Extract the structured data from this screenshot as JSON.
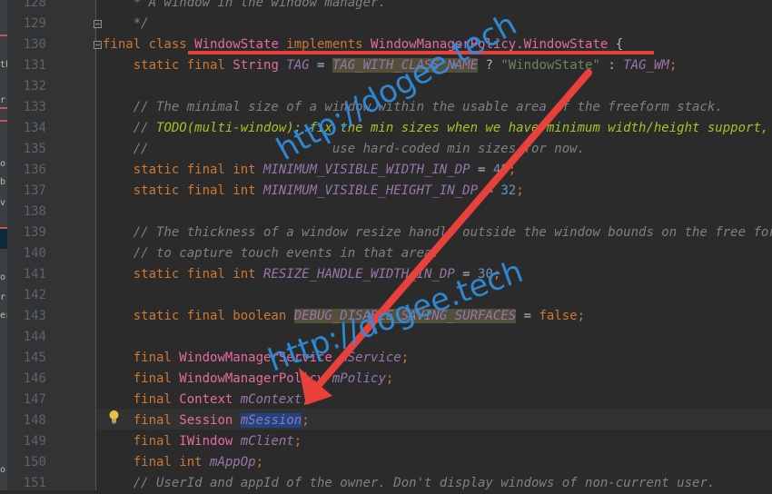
{
  "left_strip": {
    "glyphs": [
      "th",
      "r",
      "o",
      "b",
      "v",
      "o",
      "r",
      "er",
      "o"
    ]
  },
  "lines": [
    {
      "n": "128",
      "tokens": [
        {
          "t": "    * A window in the window manager.",
          "c": "cmt"
        }
      ]
    },
    {
      "n": "129",
      "tokens": [
        {
          "t": "    */",
          "c": "cmt"
        }
      ]
    },
    {
      "n": "130",
      "tokens": [
        {
          "t": "final class ",
          "c": "kw"
        },
        {
          "t": "WindowState",
          "c": "cls"
        },
        {
          "t": " implements ",
          "c": "kw"
        },
        {
          "t": "WindowManagerPolicy.WindowState",
          "c": "cls"
        },
        {
          "t": " {",
          "c": "plain"
        }
      ]
    },
    {
      "n": "131",
      "tokens": [
        {
          "t": "    static final ",
          "c": "kw"
        },
        {
          "t": "String ",
          "c": "cls"
        },
        {
          "t": "TAG",
          "c": "fld"
        },
        {
          "t": " = ",
          "c": "plain"
        },
        {
          "t": "TAG_WITH_CLASS_NAME",
          "c": "fld hl-gray"
        },
        {
          "t": " ? ",
          "c": "plain"
        },
        {
          "t": "\"WindowState\"",
          "c": "str"
        },
        {
          "t": " : ",
          "c": "plain"
        },
        {
          "t": "TAG_WM",
          "c": "fld"
        },
        {
          "t": ";",
          "c": "kw"
        }
      ]
    },
    {
      "n": "132",
      "tokens": []
    },
    {
      "n": "133",
      "tokens": [
        {
          "t": "    // The minimal size of a window within the usable area of the freeform stack.",
          "c": "cmt"
        }
      ]
    },
    {
      "n": "134",
      "tokens": [
        {
          "t": "    // ",
          "c": "cmt"
        },
        {
          "t": "TODO(multi-window): fix the min sizes when we have minimum width/height support,",
          "c": "todo"
        }
      ]
    },
    {
      "n": "135",
      "tokens": [
        {
          "t": "    //                        use hard-coded min sizes for now.",
          "c": "cmt"
        }
      ]
    },
    {
      "n": "136",
      "tokens": [
        {
          "t": "    static final int ",
          "c": "kw"
        },
        {
          "t": "MINIMUM_VISIBLE_WIDTH_IN_DP",
          "c": "fld"
        },
        {
          "t": " = ",
          "c": "plain"
        },
        {
          "t": "48",
          "c": "num"
        },
        {
          "t": ";",
          "c": "kw"
        }
      ]
    },
    {
      "n": "137",
      "tokens": [
        {
          "t": "    static final int ",
          "c": "kw"
        },
        {
          "t": "MINIMUM_VISIBLE_HEIGHT_IN_DP",
          "c": "fld"
        },
        {
          "t": " = ",
          "c": "plain"
        },
        {
          "t": "32",
          "c": "num"
        },
        {
          "t": ";",
          "c": "kw"
        }
      ]
    },
    {
      "n": "138",
      "tokens": []
    },
    {
      "n": "139",
      "tokens": [
        {
          "t": "    // The thickness of a window resize handle outside the window bounds on the free form wo",
          "c": "cmt"
        }
      ]
    },
    {
      "n": "140",
      "tokens": [
        {
          "t": "    // to capture touch events in that area.",
          "c": "cmt"
        }
      ]
    },
    {
      "n": "141",
      "tokens": [
        {
          "t": "    static final int ",
          "c": "kw"
        },
        {
          "t": "RESIZE_HANDLE_WIDTH_IN_DP",
          "c": "fld"
        },
        {
          "t": " = ",
          "c": "plain"
        },
        {
          "t": "30",
          "c": "num"
        },
        {
          "t": ";",
          "c": "kw"
        }
      ]
    },
    {
      "n": "142",
      "tokens": []
    },
    {
      "n": "143",
      "tokens": [
        {
          "t": "    static final boolean ",
          "c": "kw"
        },
        {
          "t": "DEBUG_DISABLE_SAVING_SURFACES",
          "c": "fld hl-gray"
        },
        {
          "t": " = ",
          "c": "plain"
        },
        {
          "t": "false",
          "c": "kw"
        },
        {
          "t": ";",
          "c": "kw"
        }
      ]
    },
    {
      "n": "144",
      "tokens": []
    },
    {
      "n": "145",
      "tokens": [
        {
          "t": "    final ",
          "c": "kw"
        },
        {
          "t": "WindowManagerService",
          "c": "cls"
        },
        {
          "t": " mService",
          "c": "fld"
        },
        {
          "t": ";",
          "c": "kw"
        }
      ]
    },
    {
      "n": "146",
      "tokens": [
        {
          "t": "    final ",
          "c": "kw"
        },
        {
          "t": "WindowManagerPolicy",
          "c": "cls"
        },
        {
          "t": " mPolicy",
          "c": "fld"
        },
        {
          "t": ";",
          "c": "kw"
        }
      ]
    },
    {
      "n": "147",
      "tokens": [
        {
          "t": "    final ",
          "c": "kw"
        },
        {
          "t": "Context",
          "c": "cls"
        },
        {
          "t": " mContext",
          "c": "fld"
        },
        {
          "t": ";",
          "c": "kw"
        }
      ]
    },
    {
      "n": "148",
      "tokens": [
        {
          "t": "    final ",
          "c": "kw"
        },
        {
          "t": "Session",
          "c": "cls"
        },
        {
          "t": " ",
          "c": "plain"
        },
        {
          "t": "mSession",
          "c": "fld hl-sel"
        },
        {
          "t": ";",
          "c": "kw"
        }
      ]
    },
    {
      "n": "149",
      "tokens": [
        {
          "t": "    final ",
          "c": "kw"
        },
        {
          "t": "IWindow",
          "c": "cls"
        },
        {
          "t": " mClient",
          "c": "fld"
        },
        {
          "t": ";",
          "c": "kw"
        }
      ]
    },
    {
      "n": "150",
      "tokens": [
        {
          "t": "    final int ",
          "c": "kw"
        },
        {
          "t": "mAppOp",
          "c": "fld"
        },
        {
          "t": ";",
          "c": "kw"
        }
      ]
    },
    {
      "n": "151",
      "tokens": [
        {
          "t": "    // UserId and appId of the owner. Don't display windows of non-current user.",
          "c": "cmt"
        }
      ]
    }
  ],
  "watermarks": [
    "http://dogee.tech",
    "http://dogee.tech"
  ],
  "annotation": {
    "color": "#e8403a"
  }
}
